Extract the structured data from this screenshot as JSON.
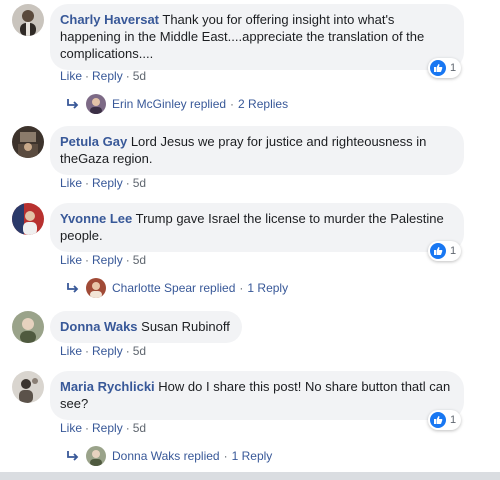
{
  "colors": {
    "link": "#385898",
    "bubble": "#f2f3f5",
    "like": "#1877f2"
  },
  "comments": [
    {
      "author": "Charly Haversat",
      "text": "Thank you for offering insight into what's happening in the Middle East....appreciate the translation of the complications....",
      "like": "Like",
      "reply": "Reply",
      "time": "5d",
      "reactions": "1",
      "replies": {
        "name": "Erin McGinley replied",
        "count": "2 Replies"
      }
    },
    {
      "author": "Petula Gay",
      "text": "Lord Jesus we pray for justice and righteousness in theGaza region.",
      "like": "Like",
      "reply": "Reply",
      "time": "5d"
    },
    {
      "author": "Yvonne Lee",
      "text": "Trump gave Israel the license to murder the Palestine people.",
      "like": "Like",
      "reply": "Reply",
      "time": "5d",
      "reactions": "1",
      "replies": {
        "name": "Charlotte Spear replied",
        "count": "1 Reply"
      }
    },
    {
      "author": "Donna Waks",
      "text": "Susan Rubinoff",
      "like": "Like",
      "reply": "Reply",
      "time": "5d"
    },
    {
      "author": "Maria Rychlicki",
      "text": "How do I share this post! No share button thatl can see?",
      "like": "Like",
      "reply": "Reply",
      "time": "5d",
      "reactions": "1",
      "replies": {
        "name": "Donna Waks replied",
        "count": "1 Reply"
      }
    }
  ]
}
